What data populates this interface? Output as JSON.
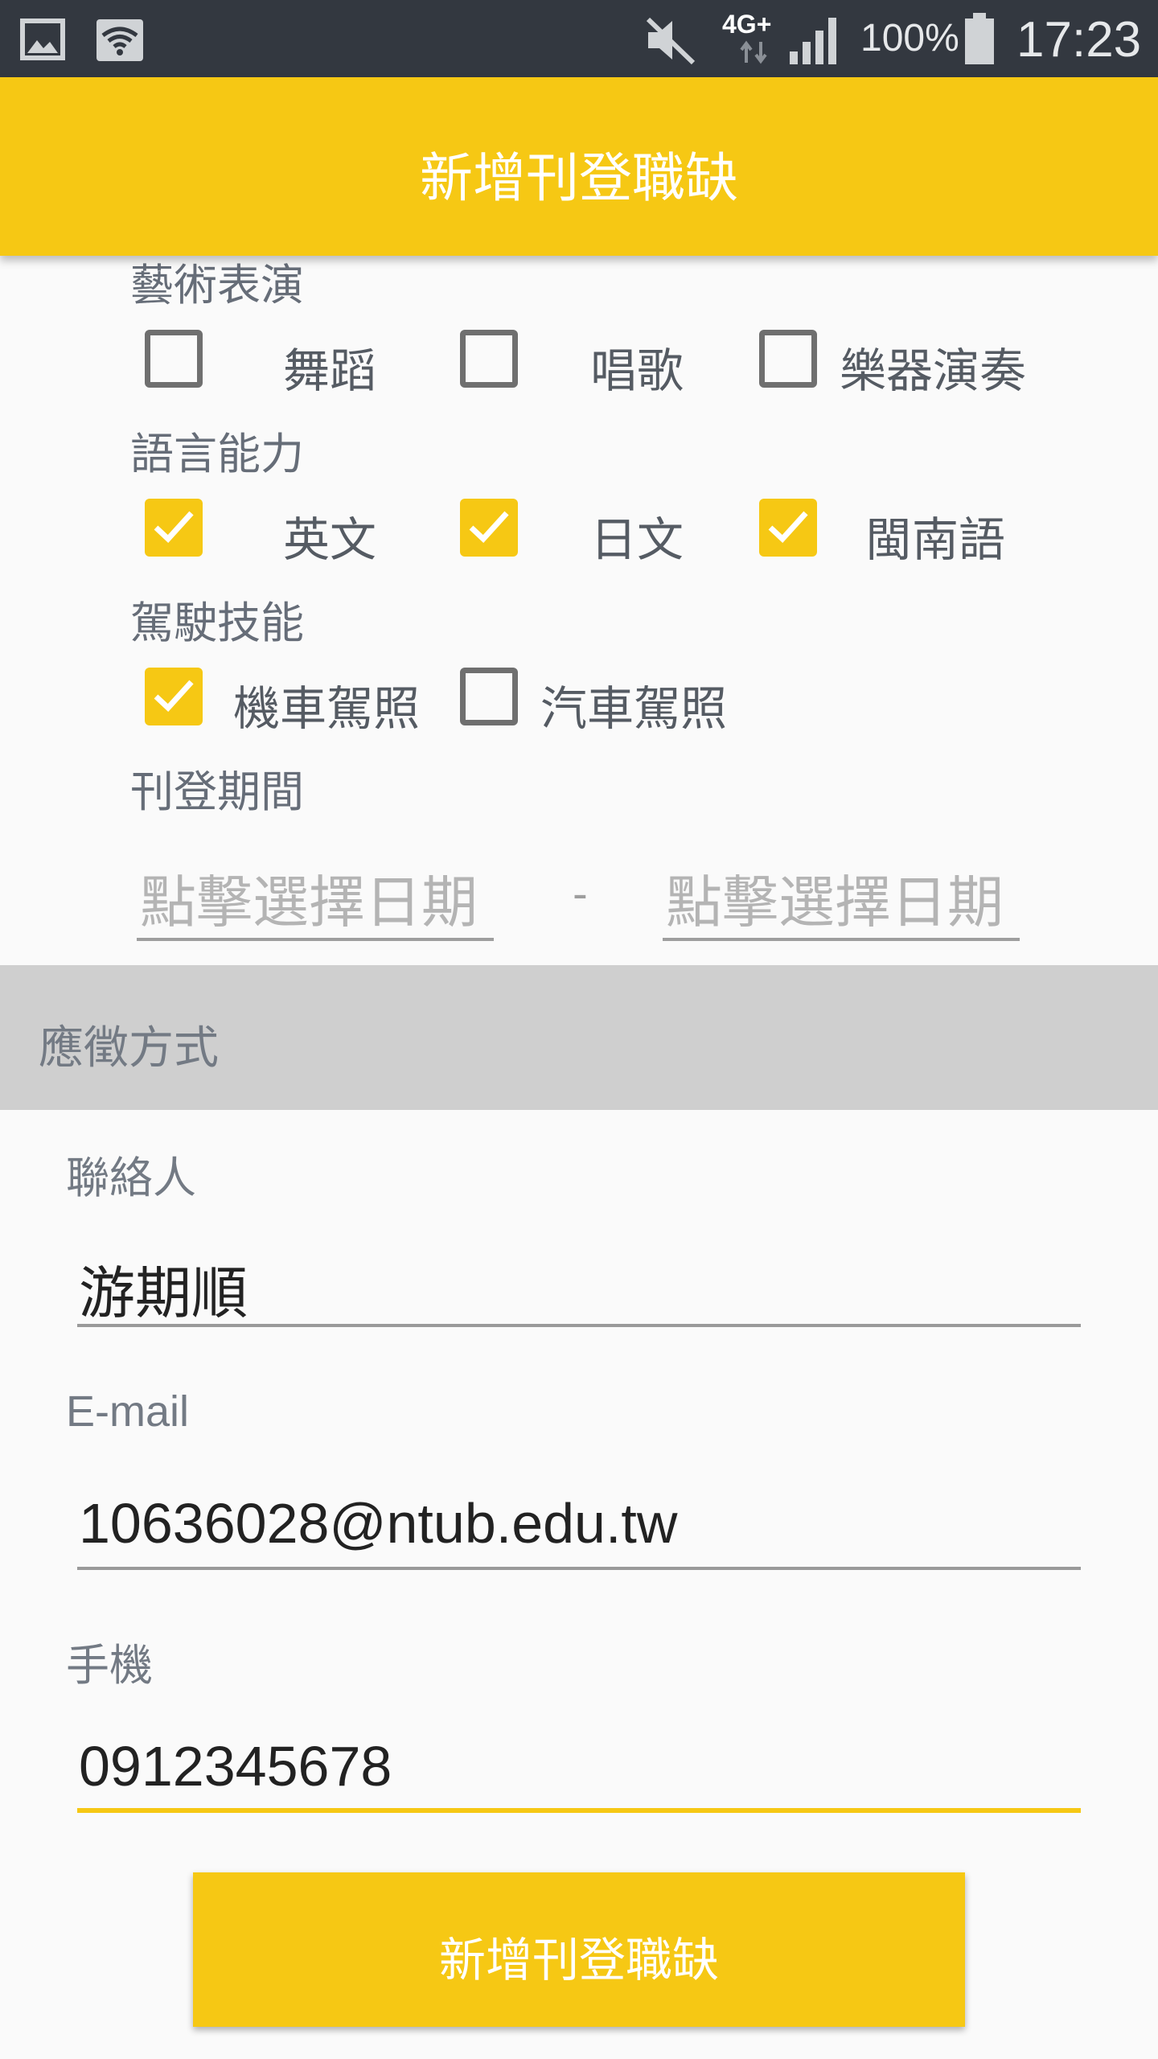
{
  "status_bar": {
    "network": "4G+",
    "battery": "100%",
    "time": "17:23",
    "icons": [
      "image-icon",
      "wifi-icon",
      "mute-icon",
      "data-arrows-icon",
      "signal-icon",
      "battery-icon"
    ]
  },
  "appbar": {
    "title": "新增刊登職缺"
  },
  "form": {
    "arts": {
      "label": "藝術表演",
      "options": [
        {
          "label": "舞蹈",
          "checked": false
        },
        {
          "label": "唱歌",
          "checked": false
        },
        {
          "label": "樂器演奏",
          "checked": false
        }
      ]
    },
    "language": {
      "label": "語言能力",
      "options": [
        {
          "label": "英文",
          "checked": true
        },
        {
          "label": "日文",
          "checked": true
        },
        {
          "label": "閩南語",
          "checked": true
        }
      ]
    },
    "driving": {
      "label": "駕駛技能",
      "options": [
        {
          "label": "機車駕照",
          "checked": true
        },
        {
          "label": "汽車駕照",
          "checked": false
        }
      ]
    },
    "period": {
      "label": "刊登期間",
      "start_placeholder": "點擊選擇日期",
      "separator": "-",
      "end_placeholder": "點擊選擇日期"
    }
  },
  "apply_section": {
    "header": "應徵方式",
    "contact": {
      "label": "聯絡人",
      "value": "游期順"
    },
    "email": {
      "label": "E-mail",
      "value": "10636028@ntub.edu.tw"
    },
    "phone": {
      "label": "手機",
      "value": "0912345678"
    }
  },
  "submit": {
    "label": "新增刊登職缺"
  },
  "colors": {
    "accent": "#f6c814",
    "status_bar": "#333840",
    "section_header_bg": "#cfcfcf"
  }
}
